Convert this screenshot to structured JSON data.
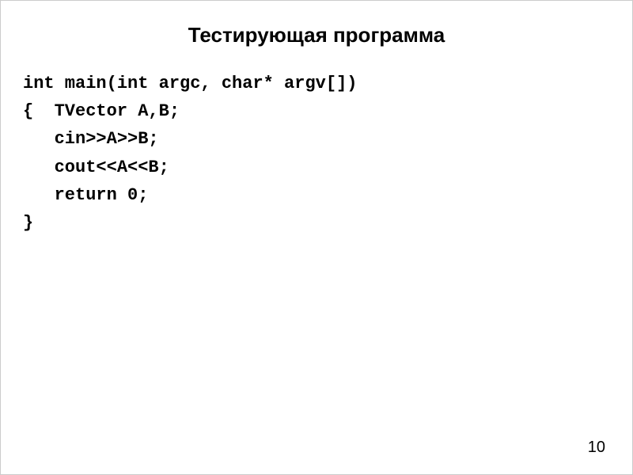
{
  "title": "Тестирующая программа",
  "code": {
    "line1": "int main(int argc, char* argv[])",
    "line2": "{  TVector A,B;",
    "line3": "   cin>>A>>B;",
    "line4": "   cout<<A<<B;",
    "line5": "   return 0;",
    "line6": "}"
  },
  "page_number": "10"
}
